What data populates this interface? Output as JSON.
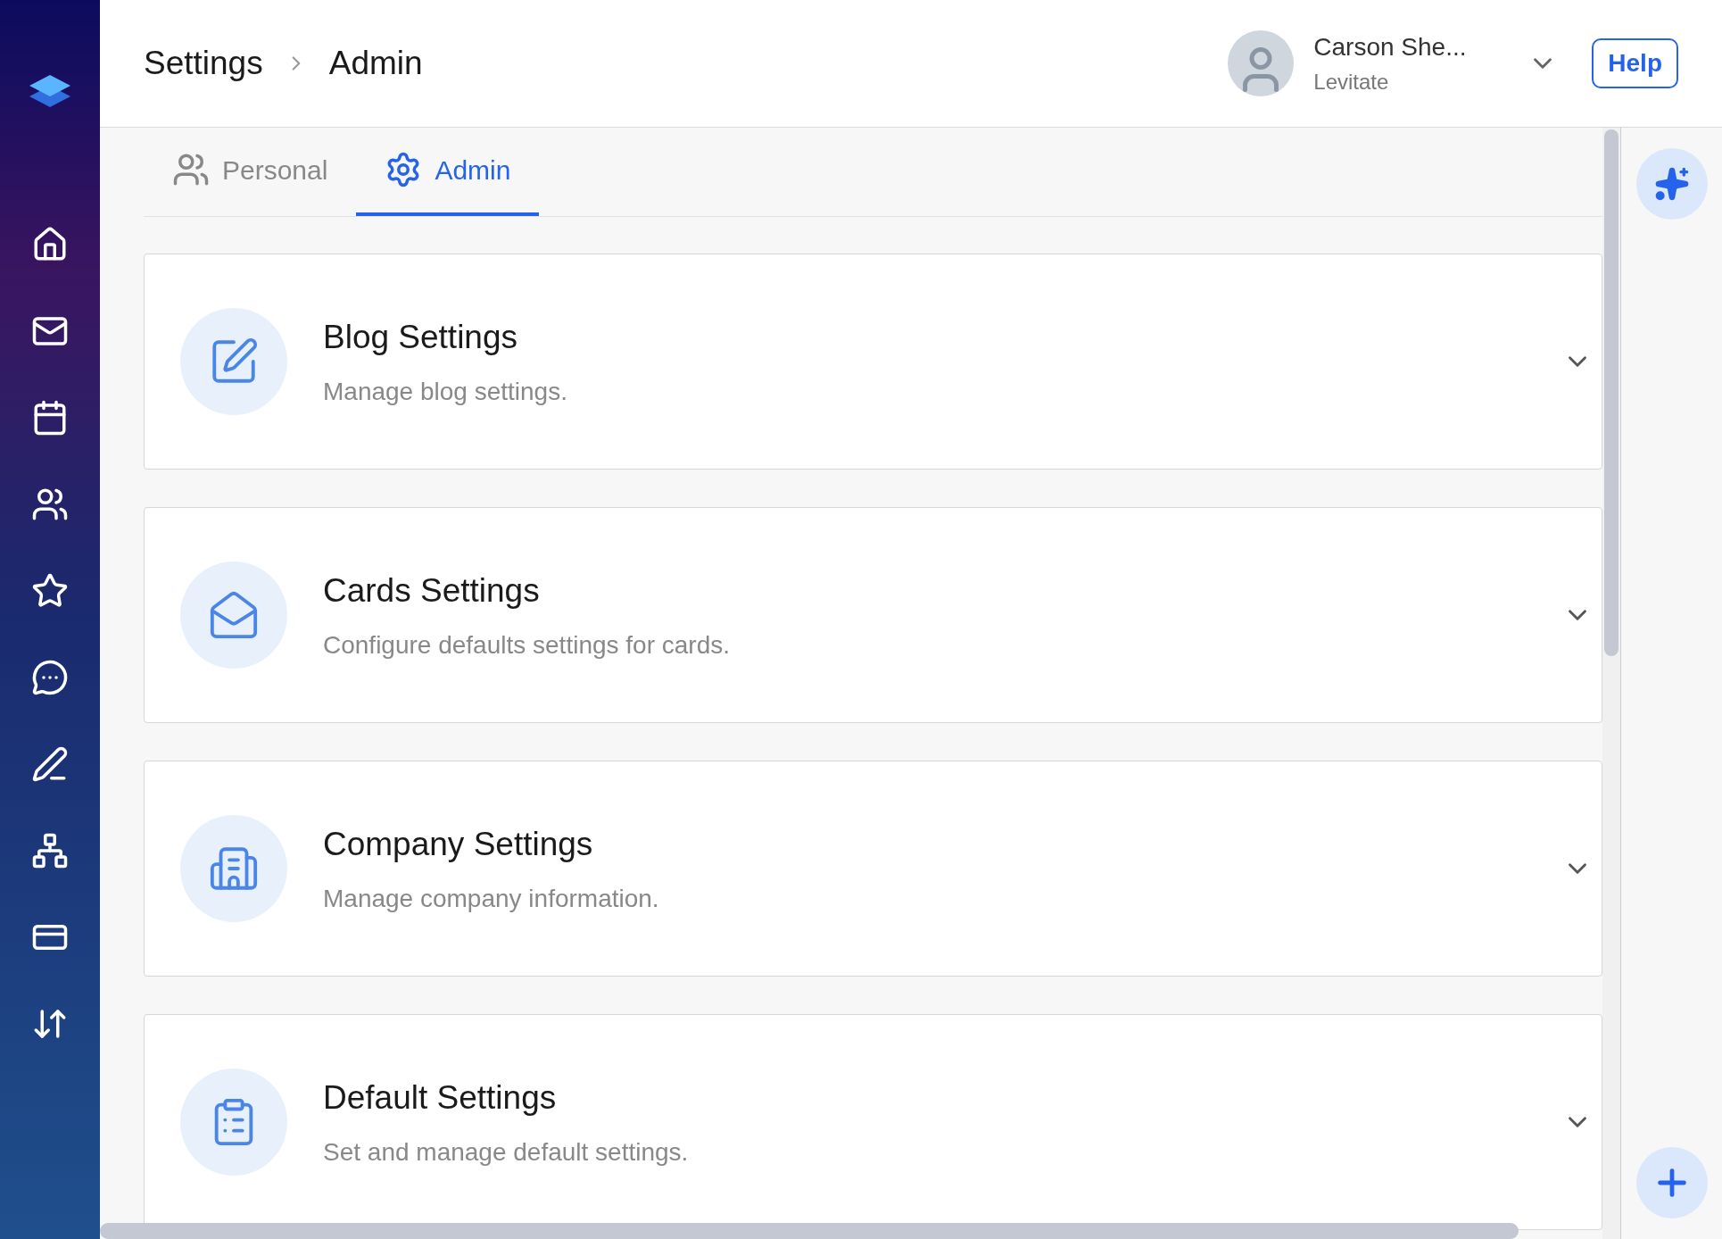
{
  "breadcrumb": [
    "Settings",
    "Admin"
  ],
  "user": {
    "name": "Carson She...",
    "organization": "Levitate"
  },
  "help_button": "Help",
  "tabs": [
    {
      "label": "Personal",
      "selected": false
    },
    {
      "label": "Admin",
      "selected": true
    }
  ],
  "cards": [
    {
      "title": "Blog Settings",
      "description": "Manage blog settings."
    },
    {
      "title": "Cards Settings",
      "description": "Configure defaults settings for cards."
    },
    {
      "title": "Company Settings",
      "description": "Manage company information."
    },
    {
      "title": "Default Settings",
      "description": "Set and manage default settings."
    }
  ]
}
